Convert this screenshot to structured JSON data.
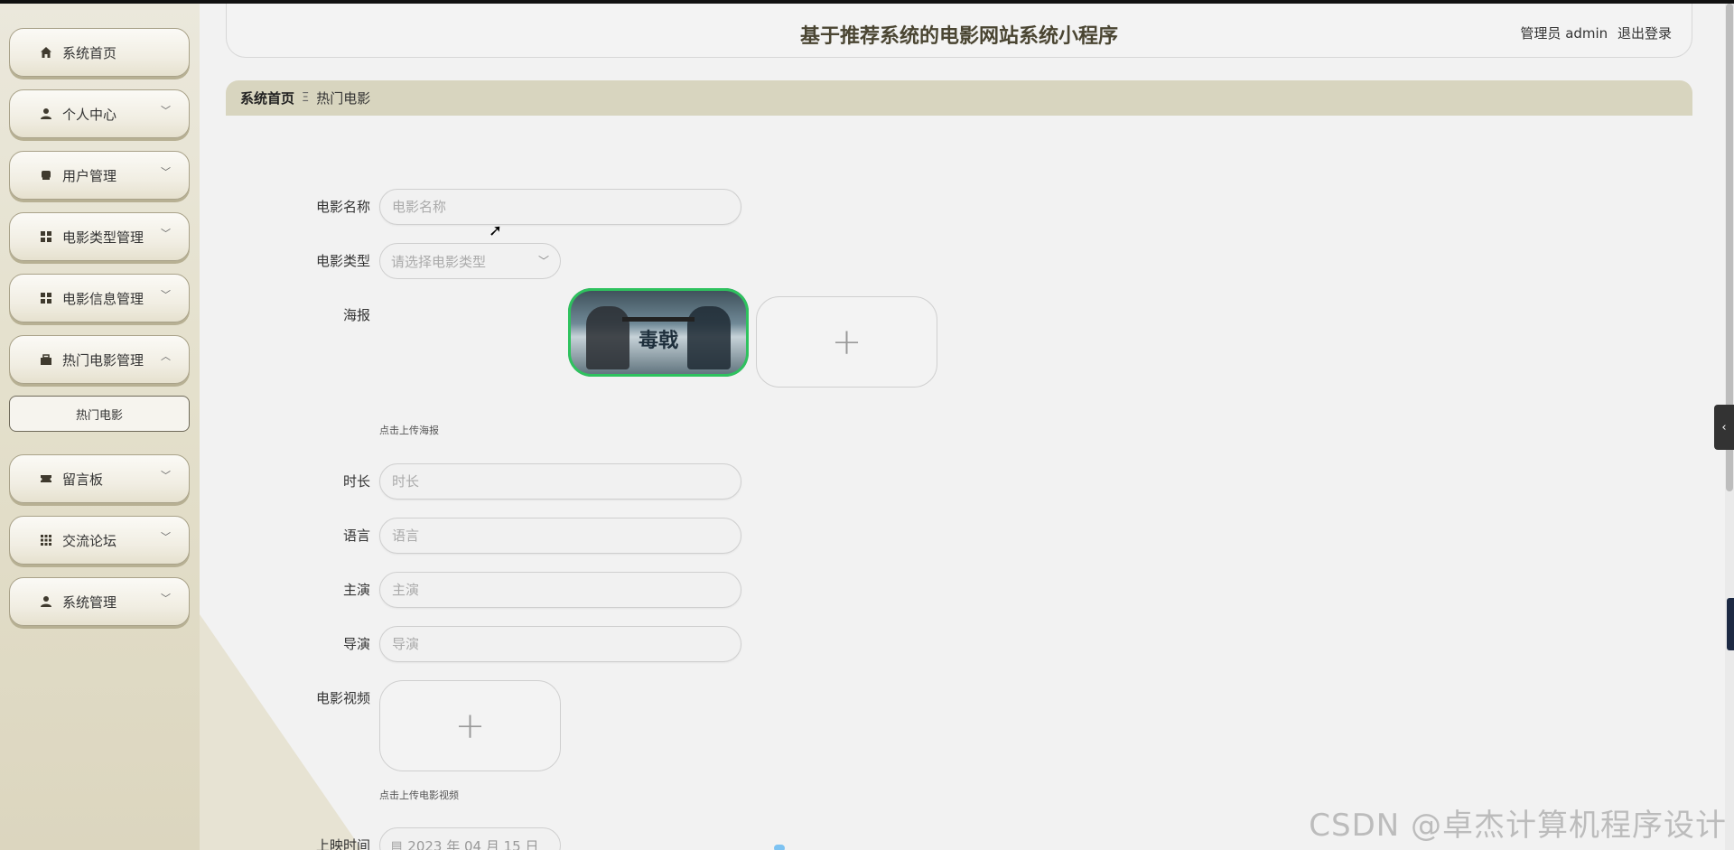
{
  "app": {
    "title": "基于推荐系统的电影网站系统小程序",
    "user_role": "管理员 admin",
    "logout": "退出登录"
  },
  "sidebar": {
    "items": [
      {
        "label": "系统首页",
        "icon": "home-icon",
        "expandable": false
      },
      {
        "label": "个人中心",
        "icon": "user-icon",
        "expandable": true
      },
      {
        "label": "用户管理",
        "icon": "users-icon",
        "expandable": true
      },
      {
        "label": "电影类型管理",
        "icon": "grid-icon",
        "expandable": true
      },
      {
        "label": "电影信息管理",
        "icon": "grid-icon",
        "expandable": true
      },
      {
        "label": "热门电影管理",
        "icon": "briefcase-icon",
        "expandable": true,
        "expanded": true
      },
      {
        "label": "留言板",
        "icon": "ticket-icon",
        "expandable": true
      },
      {
        "label": "交流论坛",
        "icon": "grid-icon",
        "expandable": true
      },
      {
        "label": "系统管理",
        "icon": "user-icon",
        "expandable": true
      }
    ],
    "submenu_active": "热门电影"
  },
  "breadcrumb": {
    "home": "系统首页",
    "separator": "Ξ",
    "current": "热门电影"
  },
  "form": {
    "movie_name": {
      "label": "电影名称",
      "placeholder": "电影名称",
      "value": ""
    },
    "movie_type": {
      "label": "电影类型",
      "placeholder": "请选择电影类型"
    },
    "poster": {
      "label": "海报",
      "hint": "点击上传海报",
      "poster_title": "毒戟"
    },
    "duration": {
      "label": "时长",
      "placeholder": "时长"
    },
    "language": {
      "label": "语言",
      "placeholder": "语言"
    },
    "lead_actor": {
      "label": "主演",
      "placeholder": "主演"
    },
    "director": {
      "label": "导演",
      "placeholder": "导演"
    },
    "video": {
      "label": "电影视频",
      "hint": "点击上传电影视频"
    },
    "release_time": {
      "label": "上映时间",
      "value": "2023 年 04 月 15 日"
    }
  },
  "watermark": "CSDN @卓杰计算机程序设计",
  "colors": {
    "sidebar_bg": "#e4e0cc",
    "breadcrumb_bg": "#d8d5bf",
    "title_color": "#4a4532",
    "poster_border": "#2ec25e"
  }
}
